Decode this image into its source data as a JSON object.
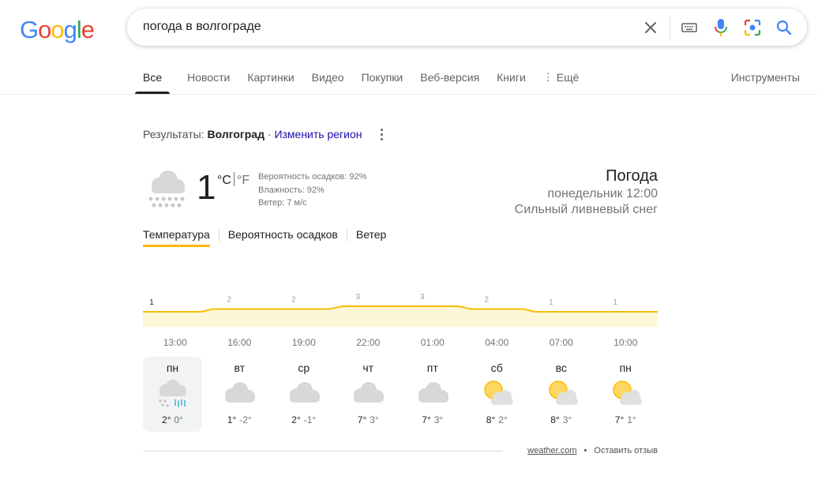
{
  "logo": "Google",
  "search": {
    "query": "погода в волгограде",
    "icons": [
      "close-icon",
      "keyboard-icon",
      "microphone-icon",
      "lens-icon",
      "search-icon"
    ]
  },
  "tabs": [
    {
      "label": "Все",
      "active": true
    },
    {
      "label": "Новости"
    },
    {
      "label": "Картинки"
    },
    {
      "label": "Видео"
    },
    {
      "label": "Покупки"
    },
    {
      "label": "Веб-версия"
    },
    {
      "label": "Книги"
    },
    {
      "label": "Ещё"
    }
  ],
  "tools_label": "Инструменты",
  "region": {
    "prefix": "Результаты:",
    "city": "Волгоград",
    "separator": "·",
    "change_label": "Изменить регион"
  },
  "weather": {
    "temperature": "1",
    "unit_c": "°C",
    "unit_f": "°F",
    "precip": "Вероятность осадков: 92%",
    "humidity": "Влажность: 92%",
    "wind": "Ветер: 7 м/с",
    "title": "Погода",
    "datetime": "понедельник 12:00",
    "condition": "Сильный ливневый снег",
    "subtabs": [
      "Температура",
      "Вероятность осадков",
      "Ветер"
    ]
  },
  "chart_data": {
    "type": "area",
    "x": [
      "13:00",
      "16:00",
      "19:00",
      "22:00",
      "01:00",
      "04:00",
      "07:00",
      "10:00"
    ],
    "values": [
      1,
      2,
      2,
      3,
      3,
      2,
      1,
      1
    ],
    "labels": [
      "1",
      "2",
      "2",
      "3",
      "3",
      "2",
      "1",
      "1"
    ],
    "color": "#fbbc04",
    "fill": "#fef7d7"
  },
  "days": [
    {
      "name": "пн",
      "hi": "2°",
      "lo": "0°",
      "icon": "snow-rain-icon",
      "active": true
    },
    {
      "name": "вт",
      "hi": "1°",
      "lo": "-2°",
      "icon": "cloudy-icon"
    },
    {
      "name": "ср",
      "hi": "2°",
      "lo": "-1°",
      "icon": "cloudy-icon"
    },
    {
      "name": "чт",
      "hi": "7°",
      "lo": "3°",
      "icon": "cloudy-icon"
    },
    {
      "name": "пт",
      "hi": "7°",
      "lo": "3°",
      "icon": "cloudy-icon"
    },
    {
      "name": "сб",
      "hi": "8°",
      "lo": "2°",
      "icon": "partly-cloudy-icon"
    },
    {
      "name": "вс",
      "hi": "8°",
      "lo": "3°",
      "icon": "partly-cloudy-icon"
    },
    {
      "name": "пн",
      "hi": "7°",
      "lo": "1°",
      "icon": "partly-cloudy-icon"
    }
  ],
  "footer": {
    "source": "weather.com",
    "dot": "•",
    "feedback": "Оставить отзыв"
  }
}
